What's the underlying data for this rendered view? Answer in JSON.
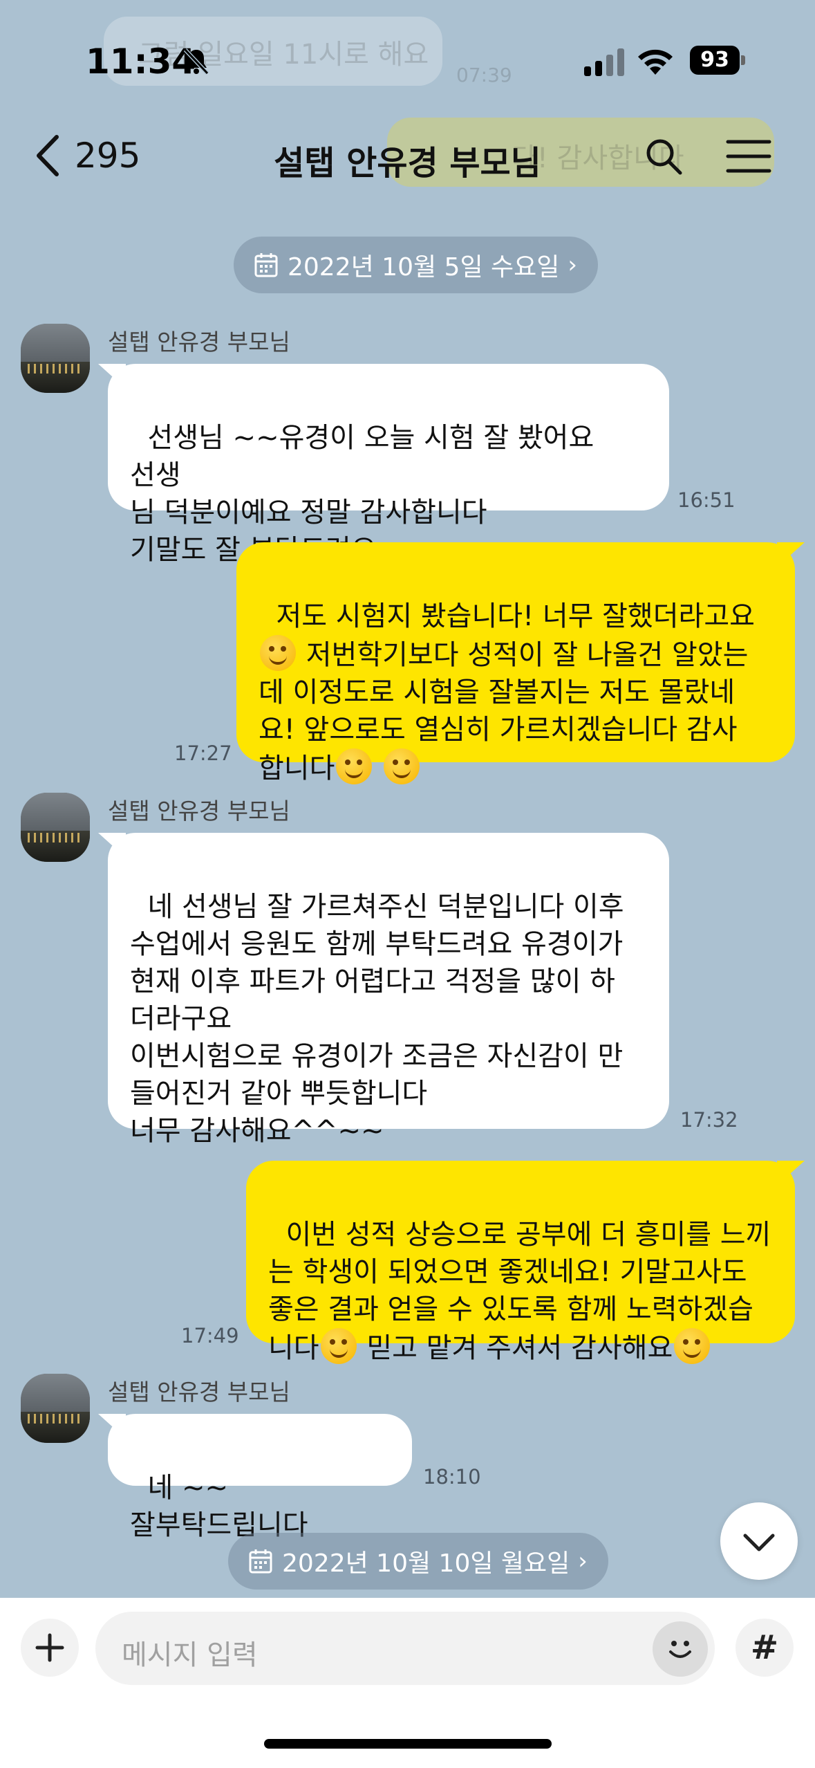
{
  "status_bar": {
    "time": "11:34",
    "battery": "93"
  },
  "header": {
    "back_count": "295",
    "title": "설탭 안유경 부모님"
  },
  "background_peek": {
    "text": "그럼 일요일 11시로 해요",
    "time": "07:39",
    "reply": "다! 감사합니다"
  },
  "dates": [
    {
      "label": "2022년 10월 5일 수요일",
      "chev": "›"
    },
    {
      "label": "2022년 10월 10일 월요일",
      "chev": "›"
    }
  ],
  "messages": [
    {
      "sender": "설탭 안유경 부모님",
      "text": "선생님 ~~유경이 오늘 시험 잘 봤어요 선생\n님 덕분이예요 정말 감사합니다\n기말도 잘 부탁드려요",
      "time": "16:51"
    },
    {
      "text_a": "저도 시험지 봤습니다! 너무 잘했더라고요\n",
      "text_b": " 저번학기보다 성적이 잘 나올건 알았는\n데 이정도로 시험을 잘볼지는 저도 몰랐네\n요! 앞으로도 열심히 가르치겠습니다 감사\n합니다",
      "time": "17:27"
    },
    {
      "sender": "설탭 안유경 부모님",
      "text": "네 선생님 잘 가르쳐주신 덕분입니다 이후\n수업에서 응원도 함께 부탁드려요 유경이가\n현재 이후 파트가 어렵다고 걱정을 많이 하\n더라구요\n이번시험으로 유경이가 조금은 자신감이 만\n들어진거 같아 뿌듯합니다\n너무 감사해요^^~~",
      "time": "17:32"
    },
    {
      "text_a": "이번 성적 상승으로 공부에 더 흥미를 느끼\n는 학생이 되었으면 좋겠네요! 기말고사도\n좋은 결과 얻을 수 있도록 함께 노력하겠습\n니다",
      "text_b": " 믿고 맡겨 주셔서 감사해요",
      "time": "17:49"
    },
    {
      "sender": "설탭 안유경 부모님",
      "text": "네 ~~잘부탁드립니다",
      "time": "18:10"
    }
  ],
  "composer": {
    "placeholder": "메시지 입력",
    "hash": "#"
  }
}
